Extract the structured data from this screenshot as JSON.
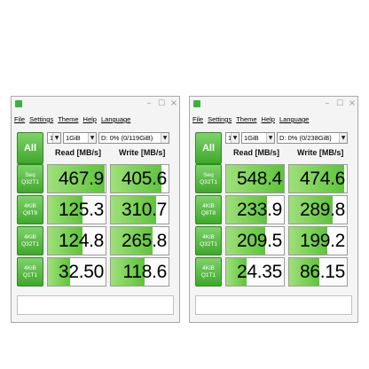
{
  "windows": [
    {
      "close_glyph": "×",
      "menu": [
        "File",
        "Settings",
        "Theme",
        "Help",
        "Language"
      ],
      "all_label": "All",
      "count": "1",
      "size": "1GiB",
      "drive": "D: 0% (0/119GiB)",
      "read_header": "Read [MB/s]",
      "write_header": "Write [MB/s]",
      "rows": [
        {
          "line1": "Seq",
          "line2": "Q32T1",
          "read": "467.9",
          "write": "405.6",
          "read_fill": 0.98,
          "write_fill": 0.88
        },
        {
          "line1": "4KiB",
          "line2": "Q8T8",
          "read": "125.3",
          "write": "310.7",
          "read_fill": 0.6,
          "write_fill": 0.78
        },
        {
          "line1": "4KiB",
          "line2": "Q32T1",
          "read": "124.8",
          "write": "265.8",
          "read_fill": 0.6,
          "write_fill": 0.72
        },
        {
          "line1": "4KiB",
          "line2": "Q1T1",
          "read": "32.50",
          "write": "118.6",
          "read_fill": 0.38,
          "write_fill": 0.58
        }
      ]
    },
    {
      "close_glyph": "×",
      "menu": [
        "File",
        "Settings",
        "Theme",
        "Help",
        "Language"
      ],
      "all_label": "All",
      "count": "1",
      "size": "1GiB",
      "drive": "D: 0% (0/238GiB)",
      "read_header": "Read [MB/s]",
      "write_header": "Write [MB/s]",
      "rows": [
        {
          "line1": "Seq",
          "line2": "Q32T1",
          "read": "548.4",
          "write": "474.6",
          "read_fill": 1.0,
          "write_fill": 0.95
        },
        {
          "line1": "4KiB",
          "line2": "Q8T8",
          "read": "233.9",
          "write": "289.8",
          "read_fill": 0.7,
          "write_fill": 0.75
        },
        {
          "line1": "4KiB",
          "line2": "Q32T1",
          "read": "209.5",
          "write": "199.2",
          "read_fill": 0.68,
          "write_fill": 0.66
        },
        {
          "line1": "4KiB",
          "line2": "Q1T1",
          "read": "24.35",
          "write": "86.15",
          "read_fill": 0.35,
          "write_fill": 0.52
        }
      ]
    }
  ]
}
